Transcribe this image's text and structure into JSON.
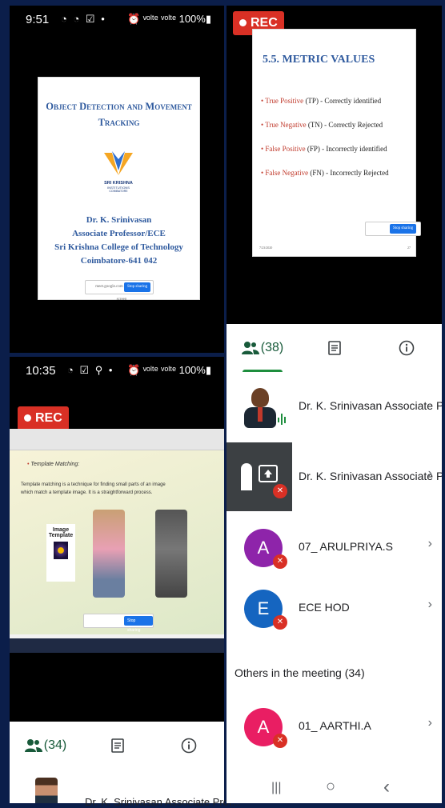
{
  "topleft": {
    "status": {
      "time": "9:51",
      "icons": "◔ ◔ ☑ •",
      "right": "⏰ ᵛᵒˡᵗᵉ ᵛᵒˡᵗᵉ 100%▮"
    },
    "slide": {
      "title_line1": "Object Detection and Movement",
      "title_line2": "Tracking",
      "logo_text": "SRI KRISHNA",
      "logo_sub": "INSTITUTIONS",
      "logo_sub2": "COIMBATORE",
      "author": "Dr. K. Srinivasan",
      "role": "Associate Professor/ECE",
      "college": "Sri Krishna College of Technology",
      "city": "Coimbatore-641 042"
    },
    "share_bar": {
      "text": "meet.google.com is sharing your screen",
      "stop": "Stop sharing",
      "hide": "Hide"
    }
  },
  "topright": {
    "rec": "REC",
    "slide": {
      "title": "5.5. METRIC VALUES",
      "items": [
        {
          "term": "True Positive",
          "rest": " (TP) - Correctly identified"
        },
        {
          "term": "True Negative",
          "rest": " (TN) - Correctly Rejected"
        },
        {
          "term": "False Positive",
          "rest": " (FP) - Incorrectly identified"
        },
        {
          "term": "False Negative",
          "rest": " (FN) - Incorrectly Rejected"
        }
      ],
      "date": "7/23/2020",
      "page": "27"
    },
    "tabs": {
      "people": "(38)"
    }
  },
  "bottomleft": {
    "status": {
      "time": "10:35",
      "icons": "◔ ☑ ⚲ •",
      "right": "⏰ ᵛᵒˡᵗᵉ ᵛᵒˡᵗᵉ 100%▮"
    },
    "rec": "REC",
    "slide": {
      "heading": "Template Matching:",
      "body": "Template matching is a technique for finding small parts of an image which match a template image. It is a straightforward process.",
      "image_label": "Image",
      "template_label": "Template"
    },
    "tabs": {
      "people": "(34)"
    },
    "partial_name": "Dr. K. Srinivasan Associate Prof..."
  },
  "participants": [
    {
      "name": "Dr. K. Srinivasan Associate Professo...",
      "avatar": "",
      "color": "#ffffff",
      "kind": "photo",
      "muted": false
    },
    {
      "name": "Dr. K. Srinivasan Associate Pro...",
      "avatar": "",
      "color": "#3c4043",
      "kind": "presenting",
      "muted": true
    },
    {
      "name": "07_ ARULPRIYA.S",
      "avatar": "A",
      "color": "#8e24aa",
      "kind": "letter",
      "muted": true
    },
    {
      "name": "ECE HOD",
      "avatar": "E",
      "color": "#1565c0",
      "kind": "letter",
      "muted": true
    }
  ],
  "others_header": "Others in the meeting (34)",
  "others": [
    {
      "name": "01_ AARTHI.A",
      "avatar": "A",
      "color": "#e91e63",
      "muted": true
    }
  ],
  "navbar": {
    "recent": "|||",
    "home": "○",
    "back": "‹"
  }
}
